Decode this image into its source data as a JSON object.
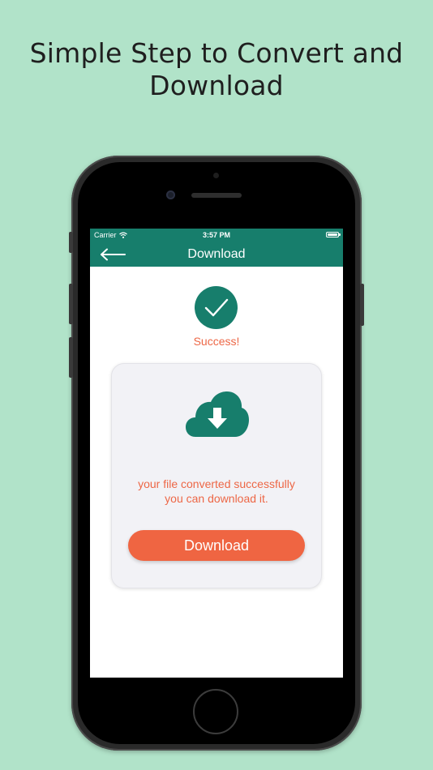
{
  "headline": {
    "line1": "Simple Step to Convert and",
    "line2": "Download"
  },
  "status_bar": {
    "carrier": "Carrier",
    "time": "3:57 PM"
  },
  "nav": {
    "title": "Download"
  },
  "content": {
    "success_label": "Success!",
    "message_line1": "your file converted successfully",
    "message_line2": "you can download it.",
    "download_button_label": "Download"
  },
  "icons": {
    "back": "arrow-left-icon",
    "success": "checkmark-icon",
    "cloud": "cloud-download-icon",
    "wifi": "wifi-icon",
    "battery": "battery-icon"
  },
  "colors": {
    "background": "#b1e3c9",
    "primary": "#177e6c",
    "accent": "#ef6542",
    "message_text": "#ed6746",
    "card_background": "#f2f2f6"
  }
}
